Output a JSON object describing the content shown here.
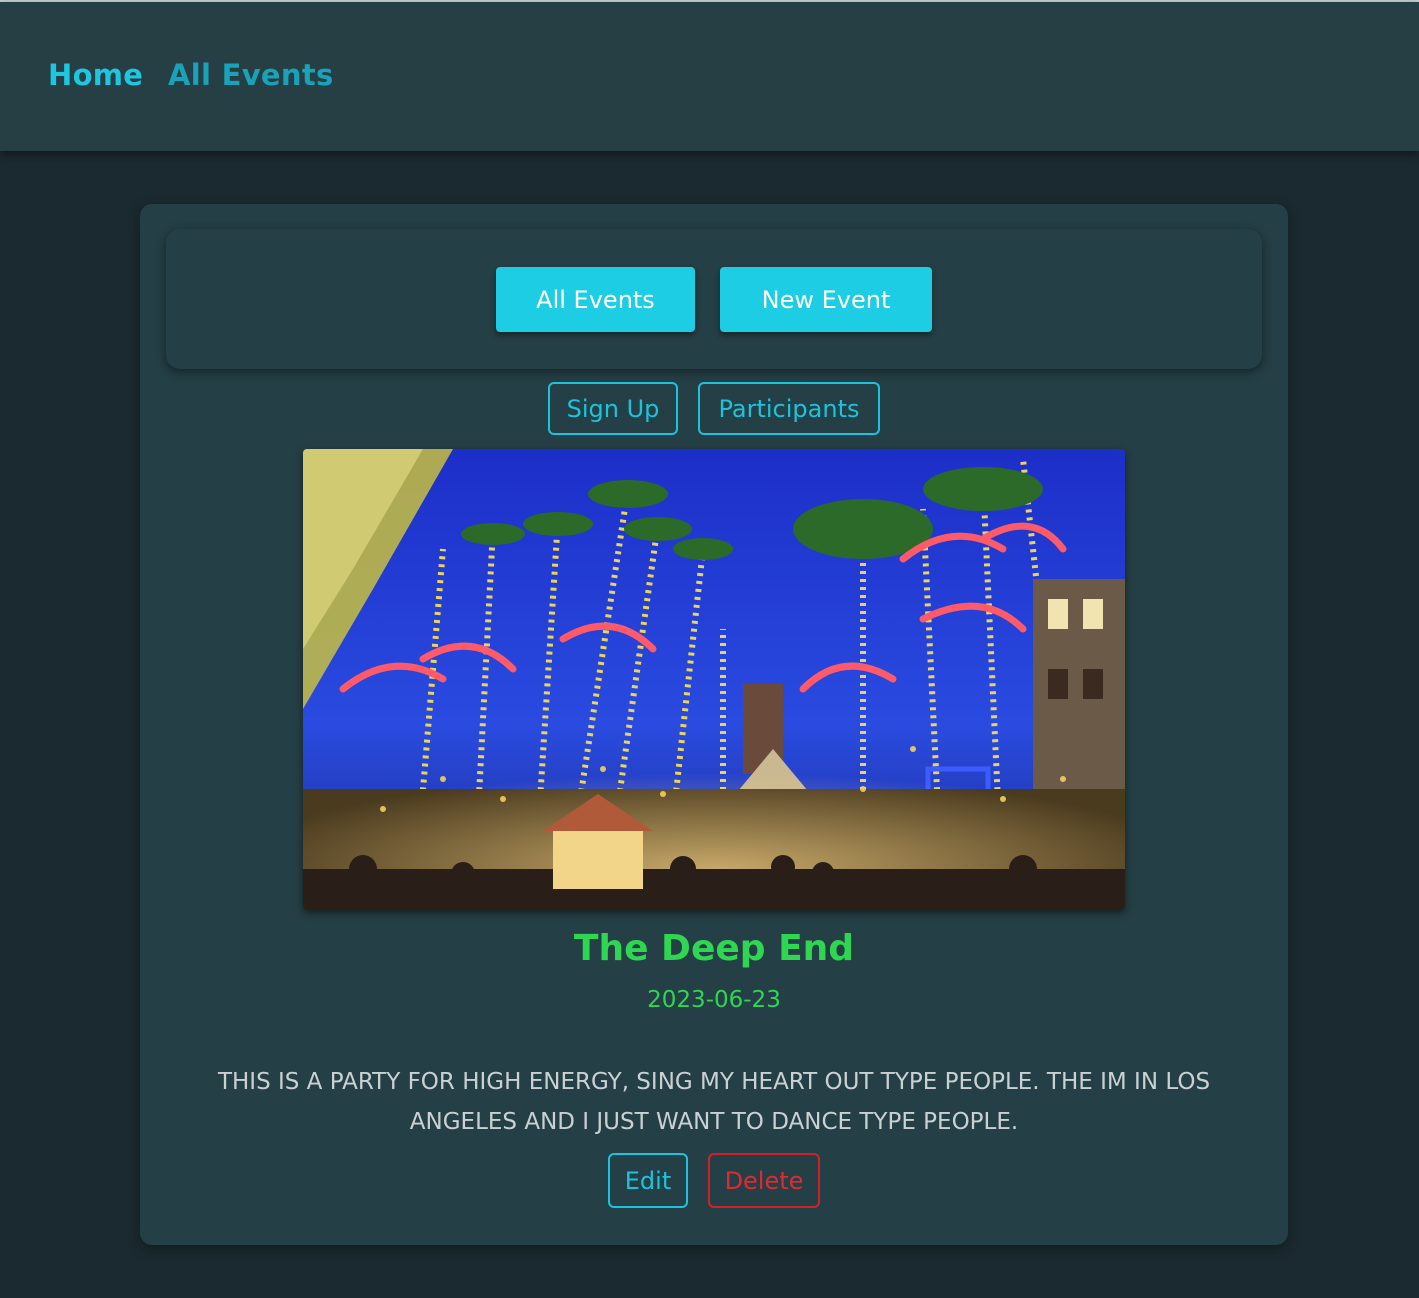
{
  "nav": {
    "home_label": "Home",
    "all_events_label": "All Events"
  },
  "toolbar": {
    "all_events_label": "All Events",
    "new_event_label": "New Event"
  },
  "actions": {
    "sign_up_label": "Sign Up",
    "participants_label": "Participants",
    "edit_label": "Edit",
    "delete_label": "Delete"
  },
  "event": {
    "title": "The Deep End",
    "date": "2023-06-23",
    "description": "THIS IS A PARTY FOR HIGH ENERGY, SING MY HEART OUT TYPE PEOPLE. THE IM IN LOS ANGELES AND I JUST WANT TO DANCE TYPE PEOPLE."
  },
  "colors": {
    "accent": "#1ccde4",
    "title_green": "#2fd652",
    "danger": "#d0222a",
    "card_bg": "#243f45",
    "page_bg": "#1b2a30"
  }
}
